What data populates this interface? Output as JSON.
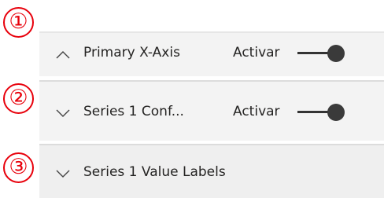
{
  "callouts": [
    "①",
    "②",
    "③"
  ],
  "sections": [
    {
      "title": "Primary X-Axis",
      "expanded": true,
      "icon": "chevron-up-icon",
      "toggle_label": "Activar",
      "toggle_on": true
    },
    {
      "title": "Series 1 Conf...",
      "expanded": false,
      "icon": "chevron-down-icon",
      "toggle_label": "Activar",
      "toggle_on": true
    },
    {
      "title": "Series 1 Value Labels",
      "expanded": false,
      "icon": "chevron-down-icon"
    }
  ],
  "colors": {
    "callout": "#e8000b",
    "section_bg": "#f3f3f3",
    "text": "#252423",
    "toggle": "#333333"
  }
}
